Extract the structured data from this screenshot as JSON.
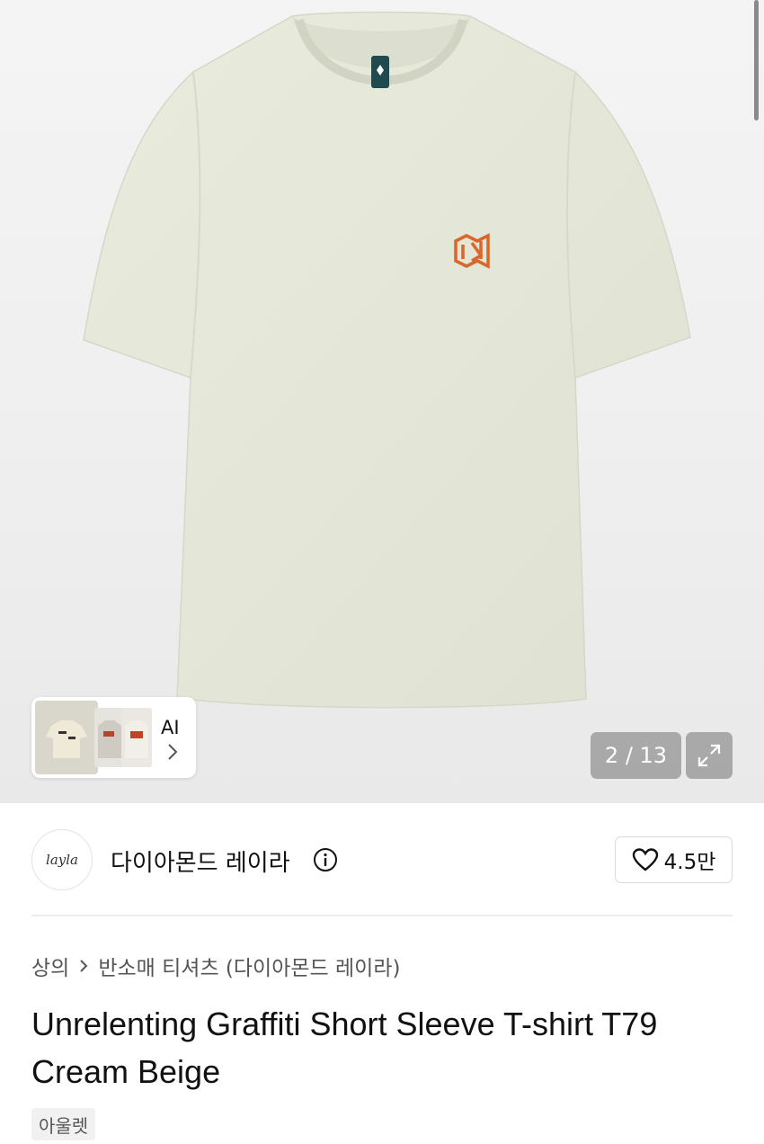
{
  "gallery": {
    "counter": "2 / 13",
    "ai_label": "AI",
    "background": "#efefef",
    "shirt_color": "#e6e8d9",
    "logo_color": "#d9672a"
  },
  "brand": {
    "logo_text": "layla",
    "name": "다이아몬드 레이라",
    "likes": "4.5만"
  },
  "breadcrumb": {
    "first": "상의",
    "second": "반소매 티셔츠 (다이아몬드 레이라)"
  },
  "product": {
    "title": "Unrelenting Graffiti Short Sleeve T-shirt T79 Cream Beige",
    "tag": "아울렛"
  },
  "icons": [
    "chevron-right-icon",
    "expand-icon",
    "info-icon",
    "heart-icon"
  ]
}
